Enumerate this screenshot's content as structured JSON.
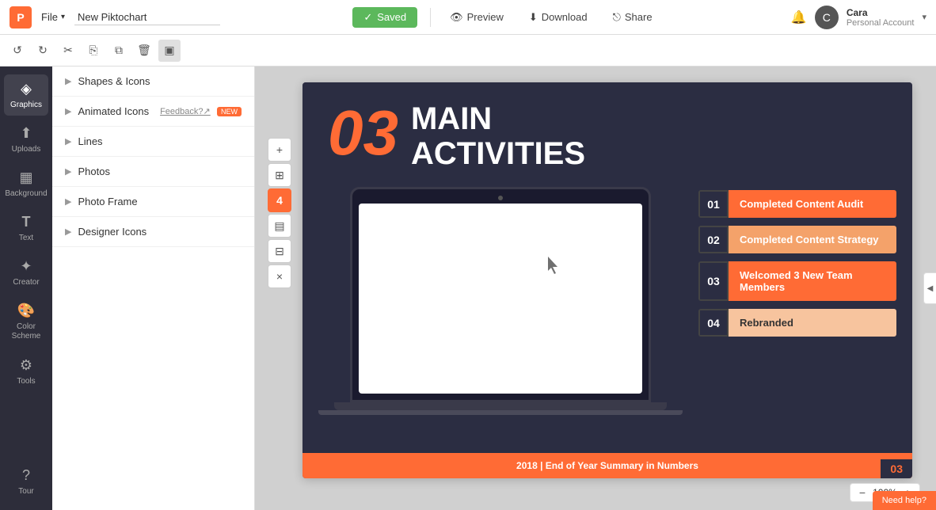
{
  "app": {
    "logo": "P",
    "file_label": "File",
    "title": "New Piktochart"
  },
  "topbar": {
    "saved_label": "Saved",
    "preview_label": "Preview",
    "download_label": "Download",
    "share_label": "Share",
    "user_name": "Cara",
    "user_account": "Personal Account"
  },
  "toolbar": {
    "undo": "↺",
    "redo": "↻",
    "cut": "✂",
    "copy": "⎘",
    "paste": "📋",
    "delete": "🗑",
    "frame": "▣"
  },
  "sidebar": {
    "items": [
      {
        "id": "graphics",
        "label": "Graphics",
        "icon": "◈"
      },
      {
        "id": "uploads",
        "label": "Uploads",
        "icon": "⬆"
      },
      {
        "id": "background",
        "label": "Background",
        "icon": "▦"
      },
      {
        "id": "text",
        "label": "Text",
        "icon": "T"
      },
      {
        "id": "creator",
        "label": "Creator",
        "icon": "✦"
      },
      {
        "id": "color-scheme",
        "label": "Color Scheme",
        "icon": "🎨"
      },
      {
        "id": "tools",
        "label": "Tools",
        "icon": "⚙"
      },
      {
        "id": "tour",
        "label": "Tour",
        "icon": "?"
      }
    ]
  },
  "panel": {
    "items": [
      {
        "id": "shapes-icons",
        "label": "Shapes & Icons",
        "badge": null,
        "new": false
      },
      {
        "id": "animated-icons",
        "label": "Animated Icons",
        "badge": "Feedback?↗",
        "new": true
      },
      {
        "id": "lines",
        "label": "Lines",
        "badge": null,
        "new": false
      },
      {
        "id": "photos",
        "label": "Photos",
        "badge": null,
        "new": false
      },
      {
        "id": "photo-frame",
        "label": "Photo Frame",
        "badge": null,
        "new": false
      },
      {
        "id": "designer-icons",
        "label": "Designer Icons",
        "badge": null,
        "new": false
      }
    ]
  },
  "float_toolbar": {
    "plus": "+",
    "align": "⊞",
    "slide4": "4",
    "slide_icon": "▤",
    "grid": "⊟",
    "close": "×"
  },
  "slide": {
    "big_number": "03",
    "title_line1": "MAIN",
    "title_line2": "ACTIVITIES",
    "activities": [
      {
        "num": "01",
        "label": "Completed Content Audit",
        "style": "orange"
      },
      {
        "num": "02",
        "label": "Completed Content Strategy",
        "style": "light"
      },
      {
        "num": "03",
        "label": "Welcomed 3 New Team Members",
        "style": "orange"
      },
      {
        "num": "04",
        "label": "Rebranded",
        "style": "lighter"
      }
    ],
    "footer_text": "2018 | End of Year Summary in Numbers",
    "footer_badge": "03"
  },
  "zoom": {
    "level": "100%",
    "minus": "−",
    "plus": "+"
  },
  "need_help": "Need help?"
}
